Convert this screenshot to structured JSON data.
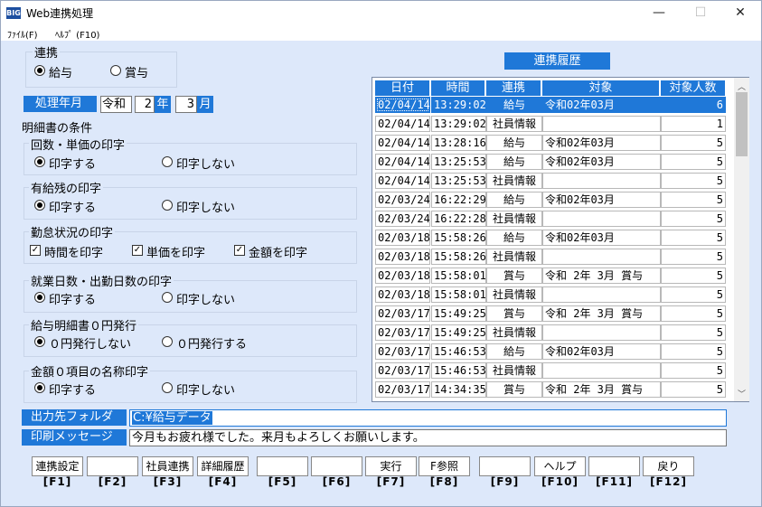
{
  "window": {
    "app_badge": "BIG",
    "title": "Web連携処理",
    "controls": {
      "minimize": "—",
      "maximize": "☐",
      "close": "✕"
    }
  },
  "menu": [
    {
      "label": "ﾌｧｲﾙ(F)"
    },
    {
      "label": "ﾍﾙﾌﾟ (F10)"
    }
  ],
  "link": {
    "title": "連携",
    "options": [
      "給与",
      "賞与"
    ],
    "selected": 0
  },
  "period": {
    "label": "処理年月",
    "era": "令和",
    "year": "2",
    "year_unit": "年",
    "month": "3",
    "month_unit": "月"
  },
  "conditions": {
    "title": "明細書の条件",
    "sections": [
      {
        "title": "回数・単価の印字",
        "options": [
          "印字する",
          "印字しない"
        ],
        "selected": 0
      },
      {
        "title": "有給残の印字",
        "options": [
          "印字する",
          "印字しない"
        ],
        "selected": 0
      },
      {
        "title": "勤怠状況の印字",
        "checks": [
          "時間を印字",
          "単価を印字",
          "金額を印字"
        ]
      },
      {
        "title": "就業日数・出勤日数の印字",
        "options": [
          "印字する",
          "印字しない"
        ],
        "selected": 0
      },
      {
        "title": "給与明細書０円発行",
        "options": [
          "０円発行しない",
          "０円発行する"
        ],
        "selected": 0
      },
      {
        "title": "金額０項目の名称印字",
        "options": [
          "印字する",
          "印字しない"
        ],
        "selected": 0
      }
    ]
  },
  "history": {
    "title": "連携履歴",
    "columns": [
      "日付",
      "時間",
      "連携",
      "対象",
      "対象人数"
    ],
    "rows": [
      [
        "02/04/14",
        "13:29:02",
        "給与",
        "令和02年03月",
        "6"
      ],
      [
        "02/04/14",
        "13:29:02",
        "社員情報",
        "",
        "1"
      ],
      [
        "02/04/14",
        "13:28:16",
        "給与",
        "令和02年03月",
        "5"
      ],
      [
        "02/04/14",
        "13:25:53",
        "給与",
        "令和02年03月",
        "5"
      ],
      [
        "02/04/14",
        "13:25:53",
        "社員情報",
        "",
        "5"
      ],
      [
        "02/03/24",
        "16:22:29",
        "給与",
        "令和02年03月",
        "5"
      ],
      [
        "02/03/24",
        "16:22:28",
        "社員情報",
        "",
        "5"
      ],
      [
        "02/03/18",
        "15:58:26",
        "給与",
        "令和02年03月",
        "5"
      ],
      [
        "02/03/18",
        "15:58:26",
        "社員情報",
        "",
        "5"
      ],
      [
        "02/03/18",
        "15:58:01",
        "賞与",
        "令和 2年 3月 賞与",
        "5"
      ],
      [
        "02/03/18",
        "15:58:01",
        "社員情報",
        "",
        "5"
      ],
      [
        "02/03/17",
        "15:49:25",
        "賞与",
        "令和 2年 3月 賞与",
        "5"
      ],
      [
        "02/03/17",
        "15:49:25",
        "社員情報",
        "",
        "5"
      ],
      [
        "02/03/17",
        "15:46:53",
        "給与",
        "令和02年03月",
        "5"
      ],
      [
        "02/03/17",
        "15:46:53",
        "社員情報",
        "",
        "5"
      ],
      [
        "02/03/17",
        "14:34:35",
        "賞与",
        "令和 2年 3月 賞与",
        "5"
      ]
    ],
    "selected_row": 0
  },
  "output": {
    "folder_label": "出力先フォルダ",
    "folder_value": "C:¥給与データ",
    "message_label": "印刷メッセージ",
    "message_value": "今月もお疲れ様でした。来月もよろしくお願いします。"
  },
  "function_keys": [
    {
      "label": "連携設定",
      "key": "[F1]"
    },
    {
      "label": "",
      "key": "[F2]"
    },
    {
      "label": "社員連携",
      "key": "[F3]"
    },
    {
      "label": "詳細履歴",
      "key": "[F4]"
    },
    {
      "label": "",
      "key": "[F5]"
    },
    {
      "label": "",
      "key": "[F6]"
    },
    {
      "label": "実行",
      "key": "[F7]"
    },
    {
      "label": "F参照",
      "key": "[F8]"
    },
    {
      "label": "",
      "key": "[F9]"
    },
    {
      "label": "ヘルプ",
      "key": "[F10]"
    },
    {
      "label": "",
      "key": "[F11]"
    },
    {
      "label": "戻り",
      "key": "[F12]"
    }
  ],
  "colors": {
    "accent": "#1f78d8",
    "background": "#dde8fa"
  }
}
